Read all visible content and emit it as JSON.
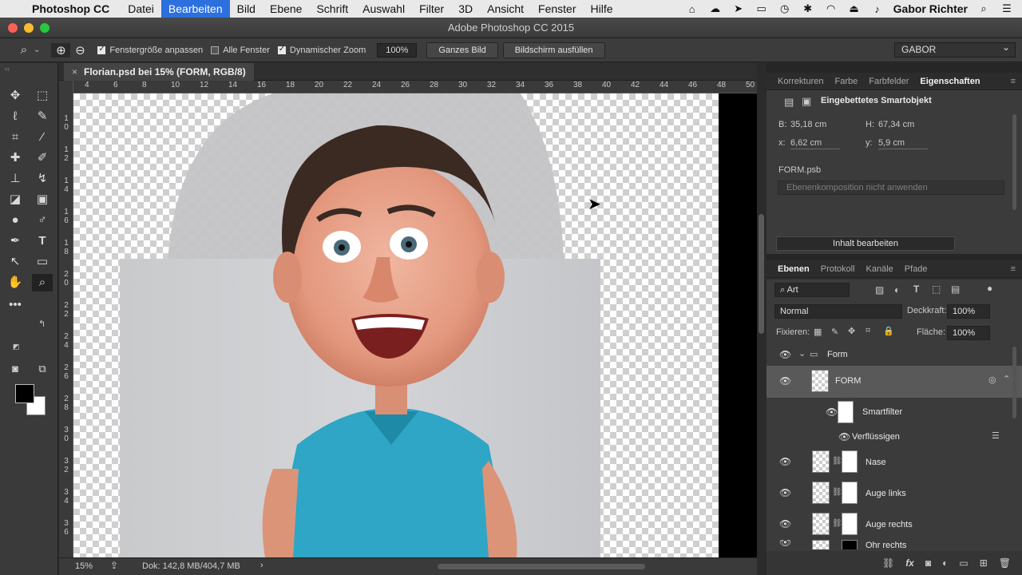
{
  "menubar": {
    "apple": "",
    "app": "Photoshop CC",
    "items": [
      "Datei",
      "Bearbeiten",
      "Bild",
      "Ebene",
      "Schrift",
      "Auswahl",
      "Filter",
      "3D",
      "Ansicht",
      "Fenster",
      "Hilfe"
    ],
    "active_index": 1,
    "user": "Gabor Richter"
  },
  "window": {
    "title": "Adobe Photoshop CC 2015"
  },
  "options": {
    "fit_window": "Fenstergröße anpassen",
    "all_windows": "Alle Fenster",
    "scrubby_zoom": "Dynamischer Zoom",
    "zoom_value": "100%",
    "fit_screen": "Ganzes Bild",
    "fill_screen": "Bildschirm ausfüllen",
    "workspace": "GABOR"
  },
  "document": {
    "tab_title": "Florian.psd bei 15% (FORM, RGB/8)",
    "close": "×",
    "ruler_top": [
      "4",
      "6",
      "8",
      "10",
      "12",
      "14",
      "16",
      "18",
      "20",
      "22",
      "24",
      "26",
      "28",
      "30",
      "32",
      "34",
      "36",
      "38",
      "40",
      "42",
      "44",
      "46",
      "48",
      "50"
    ],
    "ruler_left": [
      "1\n0",
      "1\n2",
      "1\n4",
      "1\n6",
      "1\n8",
      "2\n0",
      "2\n2",
      "2\n4",
      "2\n6",
      "2\n8",
      "3\n0",
      "3\n2",
      "3\n4",
      "3\n6"
    ]
  },
  "status": {
    "zoom": "15%",
    "doc_size": "Dok: 142,8 MB/404,7 MB",
    "arrow": "›"
  },
  "properties": {
    "tabs": [
      "Korrekturen",
      "Farbe",
      "Farbfelder",
      "Eigenschaften"
    ],
    "active_tab": 3,
    "type": "Eingebettetes Smartobjekt",
    "w_label": "B:",
    "w_value": "35,18 cm",
    "h_label": "H:",
    "h_value": "67,34 cm",
    "x_label": "x:",
    "x_value": "6,62 cm",
    "y_label": "y:",
    "y_value": "5,9 cm",
    "file": "FORM.psb",
    "comp_placeholder": "Ebenenkomposition nicht anwenden",
    "edit_contents": "Inhalt bearbeiten"
  },
  "layers": {
    "tabs": [
      "Ebenen",
      "Protokoll",
      "Kanäle",
      "Pfade"
    ],
    "active_tab": 0,
    "filter_kind": "Art",
    "blend_mode": "Normal",
    "opacity_label": "Deckkraft:",
    "opacity_value": "100%",
    "lock_label": "Fixieren:",
    "fill_label": "Fläche:",
    "fill_value": "100%",
    "group_name": "Form",
    "selected_layer": "FORM",
    "smartfilter": "Smartfilter",
    "liquify": "Verflüssigen",
    "rows": [
      "Nase",
      "Auge links",
      "Auge rechts",
      "Ohr rechts"
    ]
  }
}
